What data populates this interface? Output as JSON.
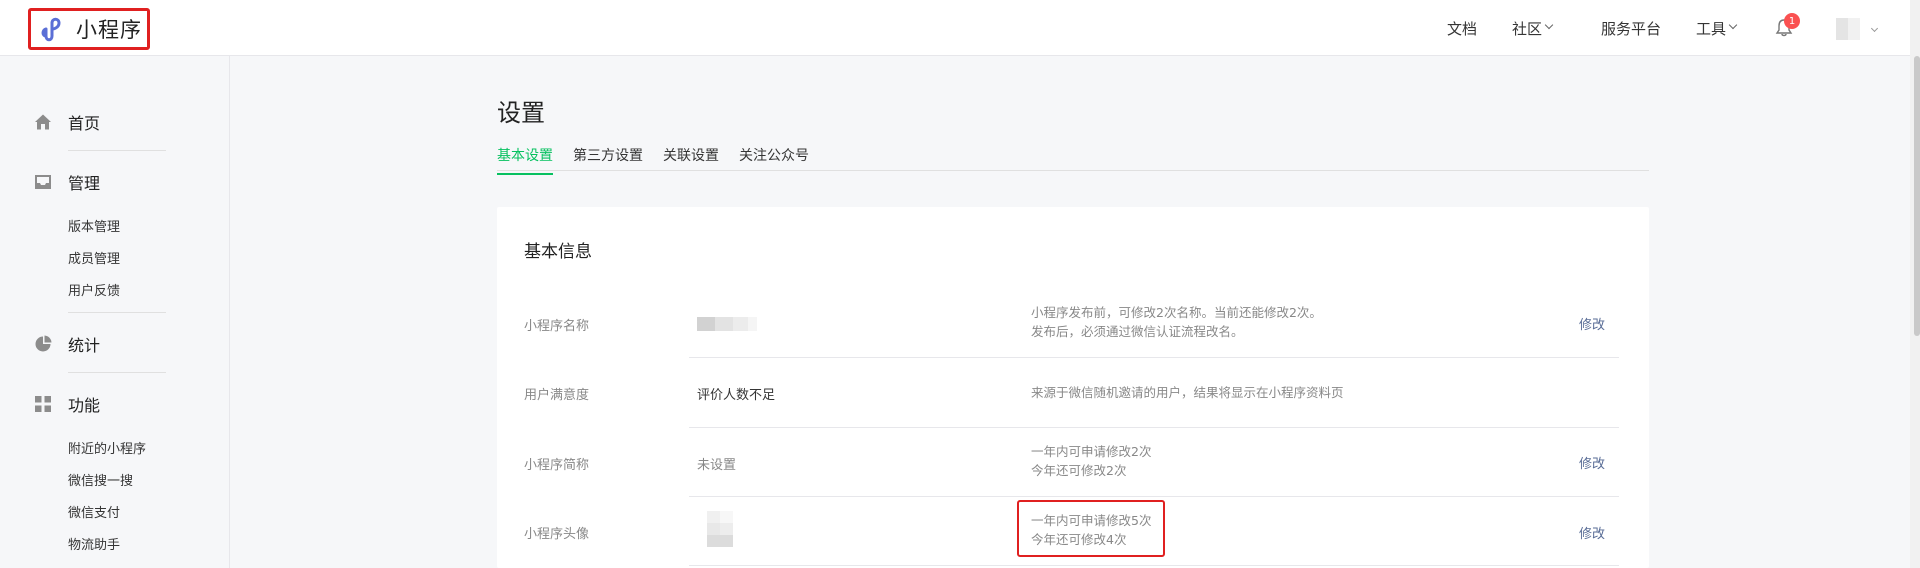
{
  "header": {
    "app_name": "小程序",
    "nav": [
      {
        "label": "文档"
      },
      {
        "label": "社区"
      },
      {
        "label": "服务平台"
      },
      {
        "label": "工具"
      }
    ],
    "notification_count": "1"
  },
  "sidebar": {
    "groups": [
      {
        "label": "首页",
        "icon": "home-icon"
      },
      {
        "label": "管理",
        "icon": "inbox-icon",
        "items": [
          "版本管理",
          "成员管理",
          "用户反馈"
        ]
      },
      {
        "label": "统计",
        "icon": "pie-chart-icon"
      },
      {
        "label": "功能",
        "icon": "grid-icon",
        "items": [
          "附近的小程序",
          "微信搜一搜",
          "微信支付",
          "物流助手"
        ]
      }
    ]
  },
  "main": {
    "title": "设置",
    "tabs": [
      "基本设置",
      "第三方设置",
      "关联设置",
      "关注公众号"
    ],
    "active_tab": "基本设置",
    "card_title": "基本信息",
    "rows": [
      {
        "label": "小程序名称",
        "value": "",
        "desc": [
          "小程序发布前，可修改2次名称。当前还能修改2次。",
          "发布后，必须通过微信认证流程改名。"
        ],
        "action": "修改"
      },
      {
        "label": "用户满意度",
        "value": "评价人数不足",
        "desc": [
          "来源于微信随机邀请的用户，结果将显示在小程序资料页"
        ],
        "action": ""
      },
      {
        "label": "小程序简称",
        "value": "未设置",
        "desc": [
          "一年内可申请修改2次",
          "今年还可修改2次"
        ],
        "action": "修改"
      },
      {
        "label": "小程序头像",
        "value": "",
        "desc": [
          "一年内可申请修改5次",
          "今年还可修改4次"
        ],
        "action": "修改"
      }
    ]
  },
  "colors": {
    "accent": "#07c160",
    "link": "#576b95",
    "highlight": "#e02020"
  }
}
